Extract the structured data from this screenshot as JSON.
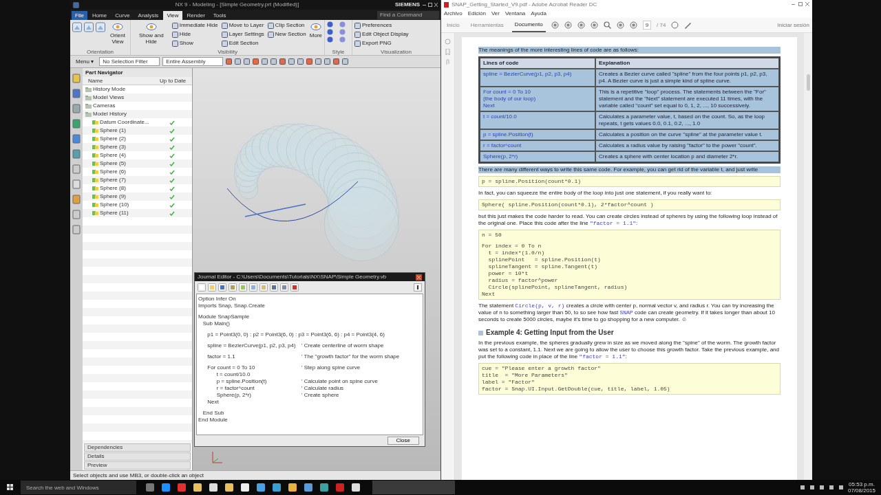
{
  "nx": {
    "title": "NX 9 - Modeling - [Simple Geometry.prt (Modified)]",
    "brand": "SIEMENS",
    "tabs": [
      {
        "label": "File",
        "selected": false
      },
      {
        "label": "Home",
        "selected": false
      },
      {
        "label": "Curve",
        "selected": false
      },
      {
        "label": "Analysis",
        "selected": false
      },
      {
        "label": "View",
        "selected": true
      },
      {
        "label": "Render",
        "selected": false
      },
      {
        "label": "Tools",
        "selected": false
      }
    ],
    "command_finder": {
      "placeholder": "Find a Command"
    },
    "groups": [
      {
        "label": "Orientation",
        "items": [
          {
            "kind": "large",
            "label": "Orient View"
          }
        ]
      },
      {
        "label": "Visibility",
        "items": [
          {
            "kind": "large",
            "label": "Show and Hide"
          },
          {
            "kind": "small",
            "label": "Immediate Hide"
          },
          {
            "kind": "small",
            "label": "Hide"
          },
          {
            "kind": "small",
            "label": "Show"
          },
          {
            "kind": "small",
            "label": "Move to Layer"
          },
          {
            "kind": "small",
            "label": "Layer Settings"
          },
          {
            "kind": "small",
            "label": "Edit Section"
          },
          {
            "kind": "small",
            "label": "Clip Section"
          },
          {
            "kind": "small",
            "label": "New Section"
          },
          {
            "kind": "large",
            "label": "More"
          }
        ]
      },
      {
        "label": "Style"
      },
      {
        "label": "Visualization",
        "items": [
          {
            "kind": "small",
            "label": "Preferences"
          },
          {
            "kind": "small",
            "label": "Edit Object Display"
          },
          {
            "kind": "small",
            "label": "Export PNG"
          }
        ]
      }
    ],
    "menu_button": "Menu ▾",
    "filters": [
      "No Selection Filter",
      "Entire Assembly"
    ],
    "navigator": {
      "title": "Part Navigator",
      "columns": [
        "Name",
        "Up to Date"
      ],
      "items": [
        {
          "label": "History Mode",
          "up_to_date": false
        },
        {
          "label": "Model Views",
          "up_to_date": false
        },
        {
          "label": "Cameras",
          "up_to_date": false
        },
        {
          "label": "Model History",
          "up_to_date": false,
          "children": [
            {
              "label": "Datum Coordinate...",
              "up_to_date": true
            },
            {
              "label": "Sphere (1)",
              "up_to_date": true
            },
            {
              "label": "Sphere (2)",
              "up_to_date": true
            },
            {
              "label": "Sphere (3)",
              "up_to_date": true
            },
            {
              "label": "Sphere (4)",
              "up_to_date": true
            },
            {
              "label": "Sphere (5)",
              "up_to_date": true
            },
            {
              "label": "Sphere (6)",
              "up_to_date": true
            },
            {
              "label": "Sphere (7)",
              "up_to_date": true
            },
            {
              "label": "Sphere (8)",
              "up_to_date": true
            },
            {
              "label": "Sphere (9)",
              "up_to_date": true
            },
            {
              "label": "Sphere (10)",
              "up_to_date": true
            },
            {
              "label": "Sphere (11)",
              "up_to_date": true
            }
          ]
        }
      ],
      "panels": [
        "Dependencies",
        "Details",
        "Preview"
      ]
    },
    "status": "Select objects and use MB3, or double-click an object"
  },
  "journal": {
    "title": "Journal Editor - C:\\Users\\Documents\\Tutorials\\NX\\SNAP\\Simple Geometry.vb",
    "sections": [
      [
        {
          "code": "Option Infer On"
        },
        {
          "code": "Imports Snap, Snap.Create"
        }
      ],
      [
        {
          "code": "Module SnapSample"
        },
        {
          "code": "   Sub Main()"
        }
      ],
      [
        {
          "code": "      p1 = Point3(0, 0) : p2 = Point3(6, 0) : p3 = Point3(6, 6) : p4 = Point3(4, 6)"
        }
      ],
      [
        {
          "code": "      spline = BezierCurve(p1, p2, p3, p4)",
          "comment": "' Create centerline of worm shape"
        }
      ],
      [
        {
          "code": "      factor = 1.1",
          "comment": "' The \"growth factor\" for the worm shape"
        }
      ],
      [
        {
          "code": "      For count = 0 To 10",
          "comment": "' Step along spine curve"
        },
        {
          "code": "            t = count/10.0"
        },
        {
          "code": "            p = spline.Position(t)",
          "comment": "' Calculate point on spine curve"
        },
        {
          "code": "            r = factor^count",
          "comment": "' Calculate radius"
        },
        {
          "code": "            Sphere(p, 2*r)",
          "comment": "' Create sphere"
        },
        {
          "code": "      Next"
        }
      ],
      [
        {
          "code": "   End Sub"
        },
        {
          "code": "End Module"
        }
      ]
    ],
    "close": "Close"
  },
  "pdf": {
    "title": "SNAP_Getting_Started_V9.pdf - Adobe Acrobat Reader DC",
    "menu": [
      "Archivo",
      "Edición",
      "Ver",
      "Ventana",
      "Ayuda"
    ],
    "tabs": [
      {
        "label": "Inicio",
        "selected": false
      },
      {
        "label": "Herramientas",
        "selected": false
      },
      {
        "label": "Documento",
        "selected": true
      }
    ],
    "page": "9",
    "pages": "/ 74",
    "sign_in": "Iniciar sesión",
    "blocks": [
      {
        "kind": "para",
        "selected": true,
        "segments": [
          {
            "text": "The meanings of the more interesting lines of code are as follows:",
            "code": false
          }
        ]
      },
      {
        "kind": "table",
        "selected": true,
        "columns": [
          "Lines of code",
          "Explanation"
        ],
        "rows": [
          [
            "spline = BezierCurve(p1, p2, p3, p4)",
            "Creates a Bezier curve called \"spline\" from the four points p1, p2, p3, p4. A Bezier curve is just a simple kind of spline curve."
          ],
          [
            "For count = 0 To 10\n   (the body of our loop)\nNext",
            "This is a repetitive \"loop\" process. The statements between the \"For\" statement and the \"Next\" statement are executed 11 times, with the variable called \"count\" set equal to 0, 1, 2, ..., 10 successively."
          ],
          [
            "t = count/10.0",
            "Calculates a parameter value, t, based on the count. So, as the loop repeats, t gets values 0.0, 0.1, 0.2, ..., 1.0"
          ],
          [
            "p = spline.Position(t)",
            "Calculates a position on the curve \"spline\" at the parameter value t."
          ],
          [
            "r = factor^count",
            "Calculates a radius value by raising \"factor\" to the power \"count\"."
          ],
          [
            "Sphere(p, 2*r)",
            "Creates a sphere with center location p and diameter 2*r."
          ]
        ]
      },
      {
        "kind": "para",
        "selected": true,
        "segments": [
          {
            "text": "There are many different ways to write this same code. For example, you can get rid of the variable t, and just write",
            "code": false
          }
        ]
      },
      {
        "kind": "code",
        "selected": false,
        "sections": [
          [
            "p = spline.Position(count*0.1)"
          ]
        ]
      },
      {
        "kind": "para",
        "selected": false,
        "segments": [
          {
            "text": "In fact, you can squeeze the entire body of the loop into just one statement, if you really want to:",
            "code": false
          }
        ]
      },
      {
        "kind": "code",
        "selected": false,
        "sections": [
          [
            "Sphere( spline.Position(count*0.1), 2*factor^count )"
          ]
        ]
      },
      {
        "kind": "para",
        "selected": false,
        "segments": [
          {
            "text": "but this just makes the code harder to read. You can create circles instead of spheres by using the following loop instead of the original one. Place this code after the line ",
            "code": false
          },
          {
            "text": "\"factor = 1.1\"",
            "code": true
          },
          {
            "text": ":",
            "code": false
          }
        ]
      },
      {
        "kind": "code",
        "selected": false,
        "sections": [
          [
            "n = 50"
          ],
          [
            "For index = 0 To n",
            "  t = index*(1.0/n)",
            "  splinePoint   = spline.Position(t)",
            "  splineTangent = spline.Tangent(t)",
            "  power = 10*t",
            "  radius = factor^power",
            "  Circle(splinePoint, splineTangent, radius)",
            "Next"
          ]
        ]
      },
      {
        "kind": "para",
        "selected": false,
        "segments": [
          {
            "text": "The statement ",
            "code": false
          },
          {
            "text": "Circle(p, v, r)",
            "code": true
          },
          {
            "text": " creates a circle with center p, normal vector v, and radius r. You can try increasing the value of n to something larger than 50, to so see how fast ",
            "code": false
          },
          {
            "text": "SNAP",
            "code": true
          },
          {
            "text": " code can create geometry. If it takes longer than about 10 seconds to create 5000 circles, maybe it's time to go shopping for a new computer. ☺",
            "code": false
          }
        ]
      },
      {
        "kind": "heading",
        "selected": false,
        "text": "Example 4: Getting Input from the User"
      },
      {
        "kind": "para",
        "selected": false,
        "segments": [
          {
            "text": "In the previous example, the spheres gradually grew in size as we moved along the \"spine\" of the worm. The growth factor was set to a constant, 1.1. Next we are going to allow the user to choose this growth factor. Take the previous example, and put the following code in place of the line ",
            "code": false
          },
          {
            "text": "\"factor = 1.1\"",
            "code": true
          },
          {
            "text": ":",
            "code": false
          }
        ]
      },
      {
        "kind": "code",
        "selected": false,
        "sections": [
          [
            "cue = \"Please enter a growth factor\"",
            "title  = \"More Parameters\"",
            "label = \"Factor\"",
            "factor = Snap.UI.Input.GetDouble(cue, title, label, 1.05)"
          ]
        ]
      }
    ]
  },
  "taskbar": {
    "search": {
      "placeholder": "Search the web and Windows"
    },
    "time": "05:53 p.m.",
    "date": "07/08/2015"
  }
}
